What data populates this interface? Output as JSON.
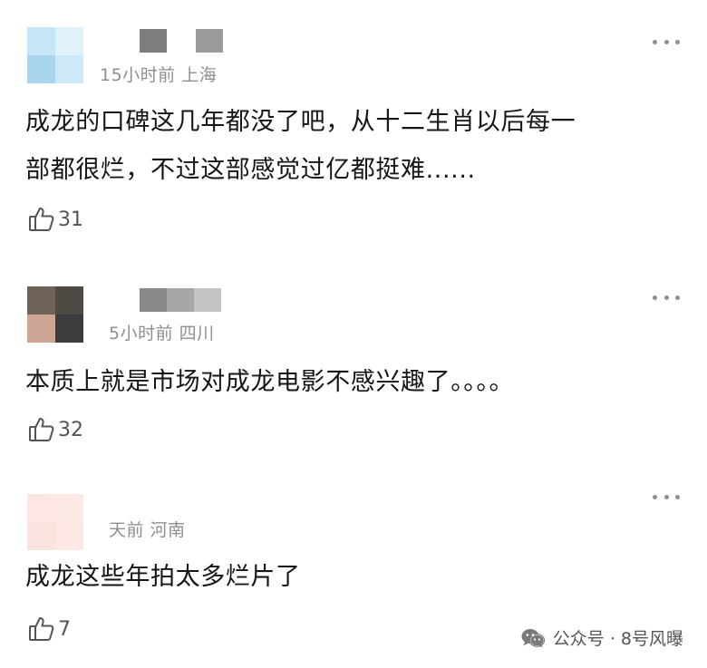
{
  "comments": [
    {
      "time_location": "15小时前 上海",
      "text_lines": [
        "成龙的口碑这几年都没了吧，从十二生肖以后每一",
        "部都很烂，不过这部感觉过亿都挺难......"
      ],
      "likes": "31",
      "avatar_colors": [
        "#c6e6f7",
        "#e2f2fb",
        "#a9d6ef",
        "#cde9f7"
      ],
      "name_colors": [
        "#7d7d7d",
        "#ffffff",
        "#9a9a9a"
      ]
    },
    {
      "time_location": "5小时前 四川",
      "text_lines": [
        "本质上就是市场对成龙电影不感兴趣了。。。。"
      ],
      "likes": "32",
      "avatar_colors": [
        "#6d6358",
        "#4f4a43",
        "#cfa596",
        "#3c3c3e"
      ],
      "name_colors": [
        "#8a8a8a",
        "#a7a7a7",
        "#c4c4c4"
      ]
    },
    {
      "time_location": "天前 河南",
      "text_lines": [
        "成龙这些年拍太多烂片了"
      ],
      "likes": "7",
      "avatar_colors": [
        "#fde6e3",
        "#fde9e6",
        "#fbe2df",
        "#fde8e5"
      ],
      "name_colors": []
    }
  ],
  "watermark": {
    "icon": "wechat-icon",
    "text": "公众号 · 8号风曝"
  }
}
